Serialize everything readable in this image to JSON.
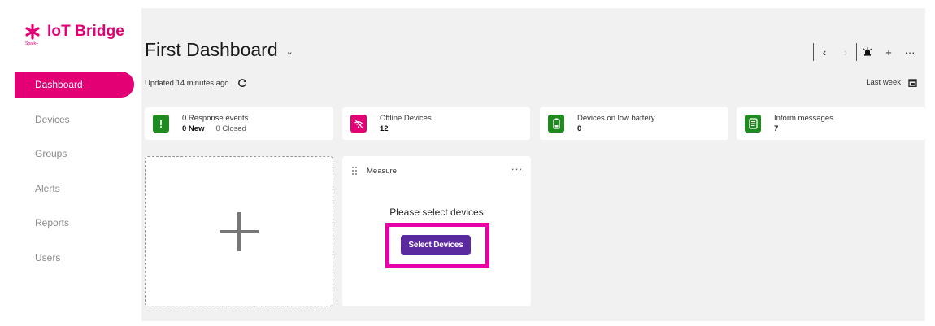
{
  "app": {
    "name": "IoT Bridge",
    "sub": "Spark+",
    "brand_color": "#e20074"
  },
  "sidebar": {
    "items": [
      {
        "label": "Dashboard",
        "active": true
      },
      {
        "label": "Devices",
        "active": false
      },
      {
        "label": "Groups",
        "active": false
      },
      {
        "label": "Alerts",
        "active": false
      },
      {
        "label": "Reports",
        "active": false
      },
      {
        "label": "Users",
        "active": false
      }
    ]
  },
  "header": {
    "title": "First Dashboard",
    "title_caret": "⌄",
    "updated": "Updated 14 minutes ago",
    "period": "Last week",
    "toolbar": {
      "prev": "‹",
      "next": "›",
      "alarm_icon": "alarm-icon",
      "add": "+",
      "more": "···"
    }
  },
  "kpis": [
    {
      "label": "0 Response events",
      "value_new": "0 New",
      "value_closed": "0 Closed",
      "icon": "exclamation-icon",
      "color": "#1f8a1f"
    },
    {
      "label": "Offline Devices",
      "value": "12",
      "icon": "offline-signal-icon",
      "color": "#e20074"
    },
    {
      "label": "Devices on low battery",
      "value": "0",
      "icon": "battery-icon",
      "color": "#1f8a1f"
    },
    {
      "label": "Inform messages",
      "value": "7",
      "icon": "message-icon",
      "color": "#1f8a1f"
    }
  ],
  "widgets": {
    "add_tile_icon": "plus-icon",
    "measure": {
      "title": "Measure",
      "menu": "···",
      "empty_text": "Please select devices",
      "button_label": "Select Devices",
      "button_color": "#5b2a9e",
      "highlight_color": "#e600a8"
    }
  }
}
